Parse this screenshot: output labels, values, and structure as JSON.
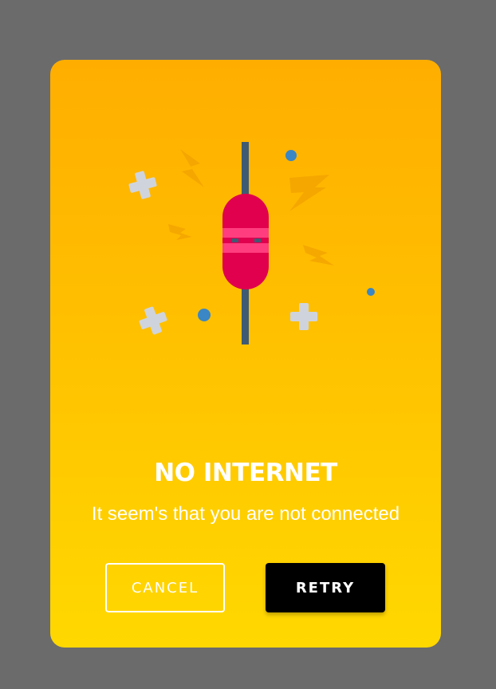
{
  "dialog": {
    "title": "NO INTERNET",
    "message": "It seem's that you are not connected",
    "cancel_label": "CANCEL",
    "retry_label": "RETRY"
  },
  "colors": {
    "backdrop": "#6b6b6b",
    "dialog_top": "#ffae00",
    "dialog_bottom": "#ffd800",
    "fuse_red": "#e0004d",
    "fuse_stripe": "#ff3d7f",
    "wire": "#3f5b74",
    "dot_blue": "#3b86c4",
    "cross_gray": "#cfd4dc",
    "retry_bg": "#000000"
  },
  "illustration": {
    "icons": [
      "fuse-icon",
      "plus-icon",
      "lightning-icon",
      "dot-icon"
    ]
  }
}
